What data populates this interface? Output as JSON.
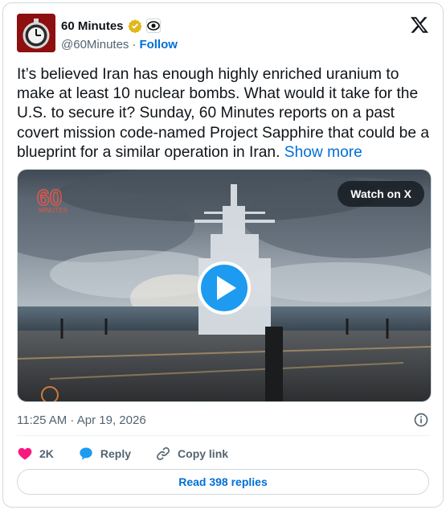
{
  "author": {
    "name": "60 Minutes",
    "handle": "@60Minutes",
    "separator": "·",
    "follow_label": "Follow",
    "avatar_icon": "stopwatch-logo",
    "verified_color": "#e2b719"
  },
  "tweet": {
    "text": "It’s believed Iran has enough highly enriched uranium to make at least 10 nuclear bombs. What would it take for the U.S. to secure it? Sunday, 60 Minutes reports on a past covert mission code-named Project Sapphire that could be a blueprint for a similar operation in Iran.",
    "show_more_label": "Show more"
  },
  "media": {
    "watch_label": "Watch on X",
    "watermark_number": "60",
    "watermark_word": "MINUTES"
  },
  "meta": {
    "timestamp": "11:25 AM · Apr 19, 2026"
  },
  "actions": {
    "likes": "2K",
    "reply_label": "Reply",
    "copy_label": "Copy link"
  },
  "replies_label": "Read 398 replies",
  "colors": {
    "link": "#006fd6",
    "like": "#f91880",
    "play": "#1d9bf0"
  }
}
